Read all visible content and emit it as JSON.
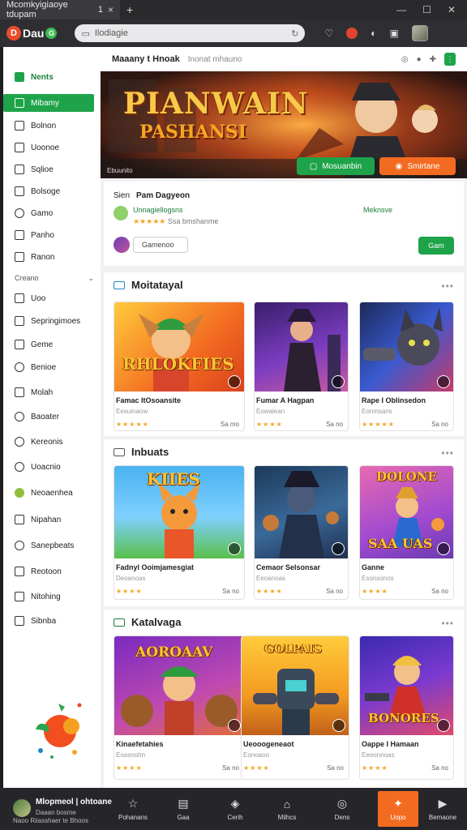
{
  "browser": {
    "tab_title": "Mcomkyigiaoye tdupam",
    "tab_num": "1",
    "close": "×",
    "newtab": "+",
    "url": "Ilodiagie",
    "win": [
      "—",
      "☐",
      "✕"
    ]
  },
  "logo": {
    "b1": "D",
    "text": "Dau",
    "b2": "G"
  },
  "sidebar": {
    "top_item": "Nents",
    "items": [
      "Mibamy",
      "Bolnon",
      "Uoonoe",
      "Sqlioe",
      "Bolsoge",
      "Gamo",
      "Panho",
      "Ranon"
    ],
    "section": "Creano",
    "items2": [
      "Uoo",
      "Sepringimoes",
      "Geme",
      "Benioe",
      "Molah",
      "Baoater",
      "Kereonis",
      "Uoacnio",
      "Neoaenhea",
      "Nipahan",
      "Sanepbeats",
      "Reotoon",
      "Nitohing",
      "Sibnba"
    ]
  },
  "main": {
    "header_title": "Maaany t Hnoak",
    "header_sub": "Inonat mhauno",
    "hero": {
      "title": "PIANWAIN",
      "subtitle": "PASHANSI",
      "caption": "Ebuunito",
      "btn1": "Mosuanbin",
      "btn2": "Smirtane"
    },
    "info": {
      "label": "Sien",
      "title": "Pam Dagyeon",
      "publisher": "Unnagiellogsns",
      "rating_text": "Ssa bmshanme",
      "stars": "★★★★★",
      "stat": "Meknsve",
      "input": "Gamenoo",
      "btn": "Gam"
    },
    "sections": [
      {
        "title": "Moitatayal",
        "cards": [
          {
            "art": "RHLOKFIES",
            "name": "Famac ItOsoansite",
            "dev": "Eesuinaow",
            "stars": "★★★★★",
            "size": "Sa mo"
          },
          {
            "art": "",
            "name": "Fumar A Hagpan",
            "dev": "Eowaiean",
            "stars": "★★★★",
            "size": "Sa no"
          },
          {
            "art": "",
            "name": "Rape I Oblinsedon",
            "dev": "Eonmsans",
            "stars": "★★★★★",
            "size": "Sa no"
          }
        ]
      },
      {
        "title": "Inbuats",
        "cards": [
          {
            "art": "KIIES",
            "name": "Fadnyl Ooimjamesgiat",
            "dev": "Deoanoas",
            "stars": "★★★★",
            "size": "Sa no"
          },
          {
            "art": "",
            "name": "Cemaor Selsonsar",
            "dev": "Eeoanoas",
            "stars": "★★★★",
            "size": "Sa no"
          },
          {
            "art": "SAA UAS",
            "art2": "DOLONE",
            "name": "Ganne",
            "dev": "Esonsonos",
            "stars": "★★★★",
            "size": "Sa no"
          }
        ]
      },
      {
        "title": "Katalvaga",
        "cards": [
          {
            "art": "AOROAAV",
            "name": "Kinaefetahies",
            "dev": "Eoasnohn",
            "stars": "★★★★",
            "size": "Sa no"
          },
          {
            "art": "GOLPAIS",
            "name": "Ueooogeneaot",
            "dev": "Eonoaoo",
            "stars": "★★★★",
            "size": "Sa no"
          },
          {
            "art": "BONORES",
            "name": "Oappe I Hamaan",
            "dev": "Eeoonnoas",
            "stars": "★★★★",
            "size": "Sa no"
          }
        ]
      }
    ]
  },
  "bottomnav": {
    "user_name": "Mlopmeol | ohtoane",
    "user_line2": "Daaan bosme",
    "user_line3": "Naoo Riiasshaer te Bhoos",
    "tabs": [
      {
        "glyph": "☆",
        "label": "Pohanans"
      },
      {
        "glyph": "▤",
        "label": "Gaa"
      },
      {
        "glyph": "◈",
        "label": "Cerih"
      },
      {
        "glyph": "⌂",
        "label": "Milhcs"
      },
      {
        "glyph": "◎",
        "label": "Dens"
      },
      {
        "glyph": "✦",
        "label": "Uopo"
      },
      {
        "glyph": "▶",
        "label": "Bemaone"
      }
    ]
  },
  "colors": {
    "accent_green": "#1ea34a",
    "accent_orange": "#f36b21"
  }
}
